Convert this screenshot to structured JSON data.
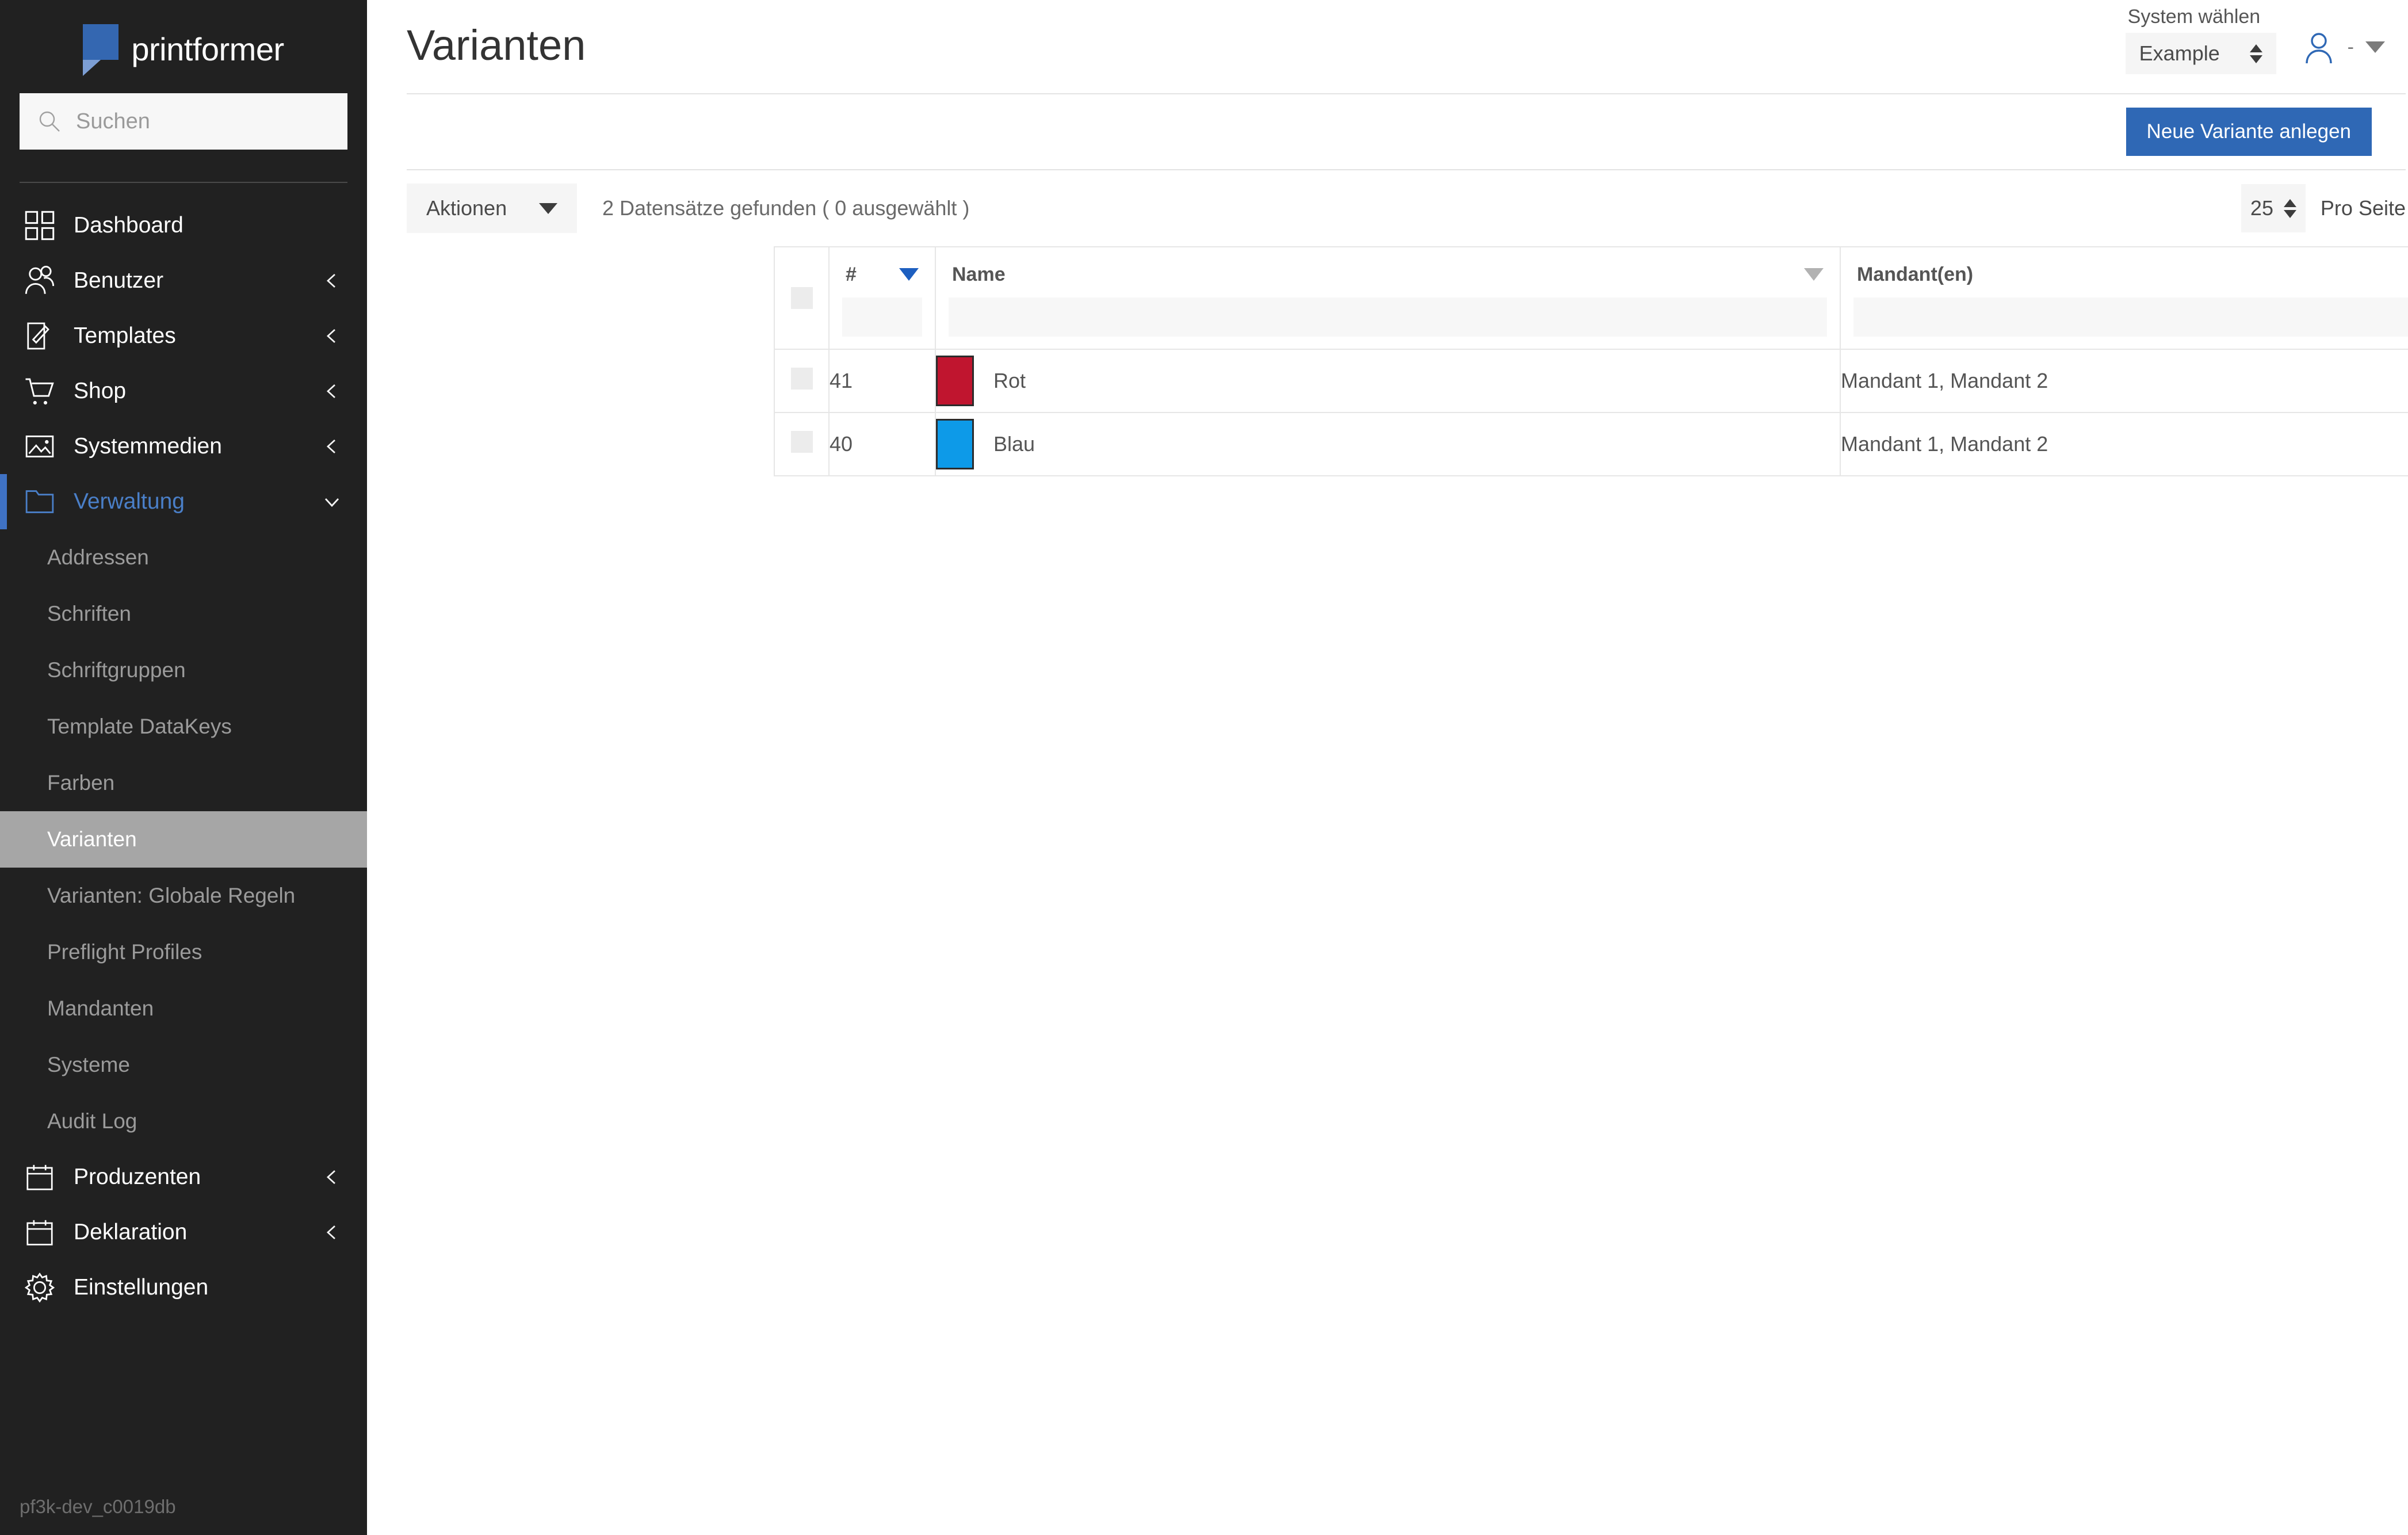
{
  "app": {
    "brand": "printformer",
    "logo_color": "#3467b1",
    "accent_color": "#3f72c4",
    "primary_button_color": "#2f68b5",
    "build_id": "pf3k-dev_c0019db"
  },
  "sidebar": {
    "search": {
      "placeholder": "Suchen",
      "value": "",
      "icon": "search-icon"
    },
    "nav": [
      {
        "label": "Dashboard",
        "icon": "grid-icon",
        "chevron": "",
        "active": false
      },
      {
        "label": "Benutzer",
        "icon": "users-icon",
        "chevron": "chevron-left-icon",
        "active": false
      },
      {
        "label": "Templates",
        "icon": "document-edit-icon",
        "chevron": "chevron-left-icon",
        "active": false
      },
      {
        "label": "Shop",
        "icon": "shopping-cart-icon",
        "chevron": "chevron-left-icon",
        "active": false
      },
      {
        "label": "Systemmedien",
        "icon": "image-icon",
        "chevron": "chevron-left-icon",
        "active": false
      },
      {
        "label": "Verwaltung",
        "icon": "folder-icon",
        "chevron": "chevron-down-icon",
        "active": true
      }
    ],
    "subnav": [
      {
        "label": "Addressen",
        "selected": false
      },
      {
        "label": "Schriften",
        "selected": false
      },
      {
        "label": "Schriftgruppen",
        "selected": false
      },
      {
        "label": "Template DataKeys",
        "selected": false
      },
      {
        "label": "Farben",
        "selected": false
      },
      {
        "label": "Varianten",
        "selected": true
      },
      {
        "label": "Varianten: Globale Regeln",
        "selected": false
      },
      {
        "label": "Preflight Profiles",
        "selected": false
      },
      {
        "label": "Mandanten",
        "selected": false
      },
      {
        "label": "Systeme",
        "selected": false
      },
      {
        "label": "Audit Log",
        "selected": false
      }
    ],
    "nav_bottom": [
      {
        "label": "Produzenten",
        "icon": "calendar-icon",
        "chevron": "chevron-left-icon"
      },
      {
        "label": "Deklaration",
        "icon": "calendar-icon",
        "chevron": "chevron-left-icon"
      },
      {
        "label": "Einstellungen",
        "icon": "gear-icon",
        "chevron": ""
      }
    ]
  },
  "header": {
    "title": "Varianten",
    "system_label": "System wählen",
    "system_value": "Example",
    "user_name": "-"
  },
  "toolbar": {
    "new_variant_button": "Neue Variante anlegen",
    "actions_label": "Aktionen",
    "record_count": "2 Datensätze gefunden ( 0 ausgewählt )",
    "per_page_value": "25",
    "per_page_label": "Pro Seite"
  },
  "table": {
    "columns": [
      {
        "key": "check",
        "label": "",
        "sortable": false,
        "sort_active": false,
        "has_filter": false
      },
      {
        "key": "id",
        "label": "#",
        "sortable": true,
        "sort_active": true,
        "has_filter": true
      },
      {
        "key": "name",
        "label": "Name",
        "sortable": true,
        "sort_active": false,
        "has_filter": true
      },
      {
        "key": "mandant",
        "label": "Mandant(en)",
        "sortable": true,
        "sort_active": false,
        "has_filter": true
      }
    ],
    "filters": {
      "id": "",
      "name": "",
      "mandant": ""
    },
    "rows": [
      {
        "checked": false,
        "id": "41",
        "name": "Rot",
        "swatch": "#c0152f",
        "mandant": "Mandant 1, Mandant 2"
      },
      {
        "checked": false,
        "id": "40",
        "name": "Blau",
        "swatch": "#0d9ae8",
        "mandant": "Mandant 1, Mandant 2"
      }
    ]
  }
}
